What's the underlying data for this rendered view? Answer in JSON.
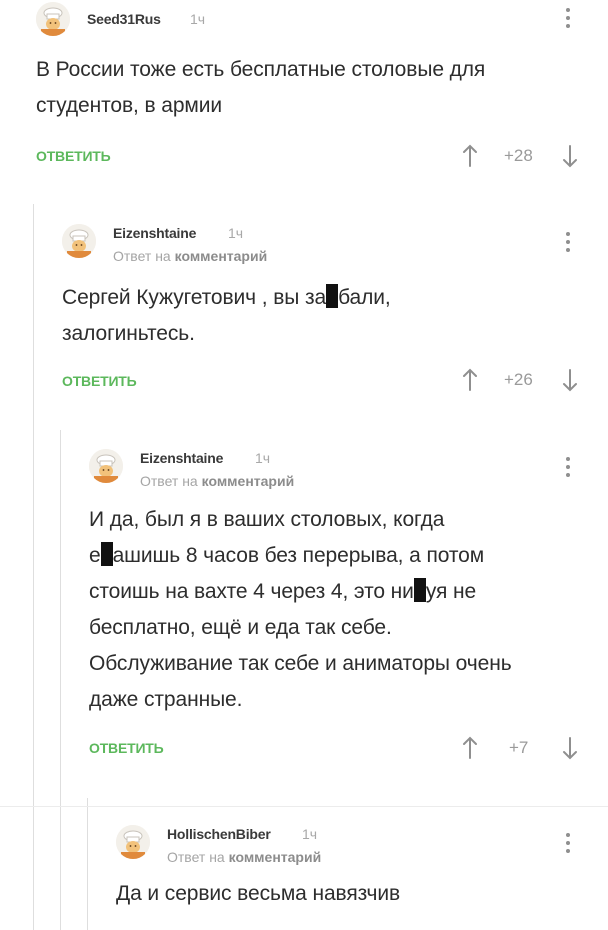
{
  "comments": [
    {
      "author": "Seed31Rus",
      "time": "1ч",
      "reply_to_prefix": "",
      "reply_to_link": "",
      "text_lines": [
        "В России тоже есть бесплатные столовые для",
        "студентов, в армии"
      ],
      "reply_label": "ОТВЕТИТЬ",
      "rating": "+28"
    },
    {
      "author": "Eizenshtaine",
      "time": "1ч",
      "reply_to_prefix": "Ответ на",
      "reply_to_link": "комментарий",
      "text_parts": [
        "Сергей Кужугетович , вы за",
        "бали,",
        "залогиньтесь."
      ],
      "reply_label": "ОТВЕТИТЬ",
      "rating": "+26"
    },
    {
      "author": "Eizenshtaine",
      "time": "1ч",
      "reply_to_prefix": "Ответ на",
      "reply_to_link": "комментарий",
      "text_parts": [
        "И да, был я в ваших столовых, когда",
        "е",
        "ашишь 8 часов без перерыва, а потом",
        "стоишь на вахте 4 через 4, это ни",
        "уя не",
        "бесплатно, ещё и еда так себе.",
        "Обслуживание так себе и аниматоры очень",
        "даже странные."
      ],
      "reply_label": "ОТВЕТИТЬ",
      "rating": "+7"
    },
    {
      "author": "HollischenBiber",
      "time": "1ч",
      "reply_to_prefix": "Ответ на",
      "reply_to_link": "комментарий",
      "text_lines": [
        "Да и сервис весьма навязчив"
      ]
    }
  ],
  "colors": {
    "reply": "#5cb85c",
    "text": "#2d2d2d",
    "muted": "#a8a8a8"
  },
  "icons": [
    "avatar-cook-icon",
    "more-vertical-icon",
    "arrow-up-icon",
    "arrow-down-icon"
  ]
}
